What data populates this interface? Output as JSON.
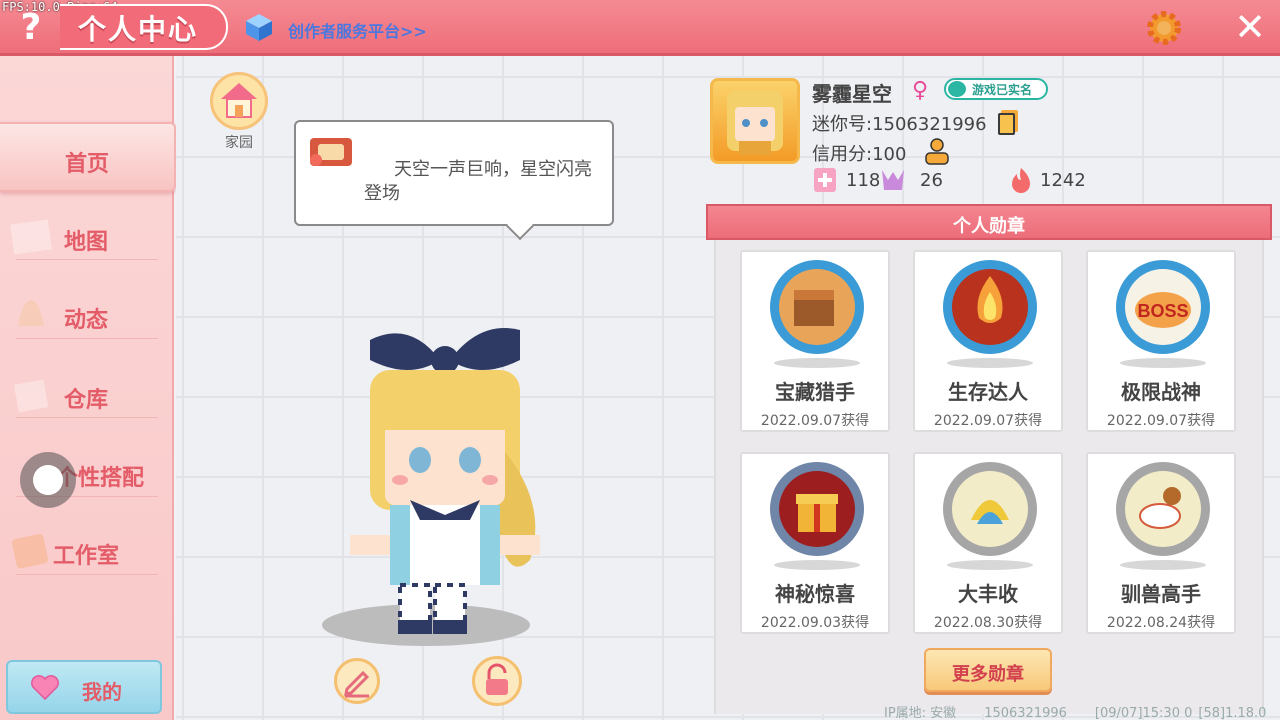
{
  "debug": {
    "fps_ping": "FPS:10.0  Ping:64"
  },
  "header": {
    "title": "个人中心",
    "creator_link": "创作者服务平台>>",
    "help_icon": "question-mark",
    "settings_icon": "gear-icon",
    "close_icon": "close-icon"
  },
  "sidebar": {
    "items": [
      {
        "label": "首页",
        "active": true
      },
      {
        "label": "地图"
      },
      {
        "label": "动态"
      },
      {
        "label": "仓库"
      },
      {
        "label": "个性搭配"
      },
      {
        "label": "工作室"
      }
    ],
    "mine_label": "我的"
  },
  "home": {
    "label": "家园"
  },
  "bubble": {
    "text": "天空一声巨响，星空闪亮登场"
  },
  "profile": {
    "name": "雾霾星空",
    "gender_symbol": "♀",
    "verified": "游戏已实名",
    "mini_id": "迷你号:1506321996",
    "credit": "信用分:100",
    "stats": [
      {
        "icon": "add-friend-icon",
        "value": "118"
      },
      {
        "icon": "fans-icon",
        "value": "26"
      },
      {
        "icon": "fire-icon",
        "value": "1242"
      }
    ]
  },
  "medals": {
    "header": "个人勋章",
    "items": [
      {
        "name": "宝藏猎手",
        "date": "2022.09.07获得",
        "tier": "blue",
        "icon": "treasure-chest-icon"
      },
      {
        "name": "生存达人",
        "date": "2022.09.07获得",
        "tier": "blue",
        "icon": "campfire-icon"
      },
      {
        "name": "极限战神",
        "date": "2022.09.07获得",
        "tier": "blue",
        "icon": "boss-icon",
        "badge_text": "BOSS"
      },
      {
        "name": "神秘惊喜",
        "date": "2022.09.03获得",
        "tier": "silver",
        "icon": "gift-box-icon"
      },
      {
        "name": "大丰收",
        "date": "2022.08.30获得",
        "tier": "silver",
        "icon": "harvest-icon"
      },
      {
        "name": "驯兽高手",
        "date": "2022.08.24获得",
        "tier": "silver",
        "icon": "horse-rider-icon"
      }
    ],
    "more_label": "更多勋章"
  },
  "footer": {
    "ip": "IP属地: 安徽",
    "uid": "1506321996",
    "time": "[09/07]15:30 0",
    "version": "[58]1.18.0"
  },
  "colors": {
    "primary": "#ee6e7a",
    "sidebar": "#f9c9c9",
    "accent_text": "#e35c68",
    "link": "#4a78e0"
  }
}
